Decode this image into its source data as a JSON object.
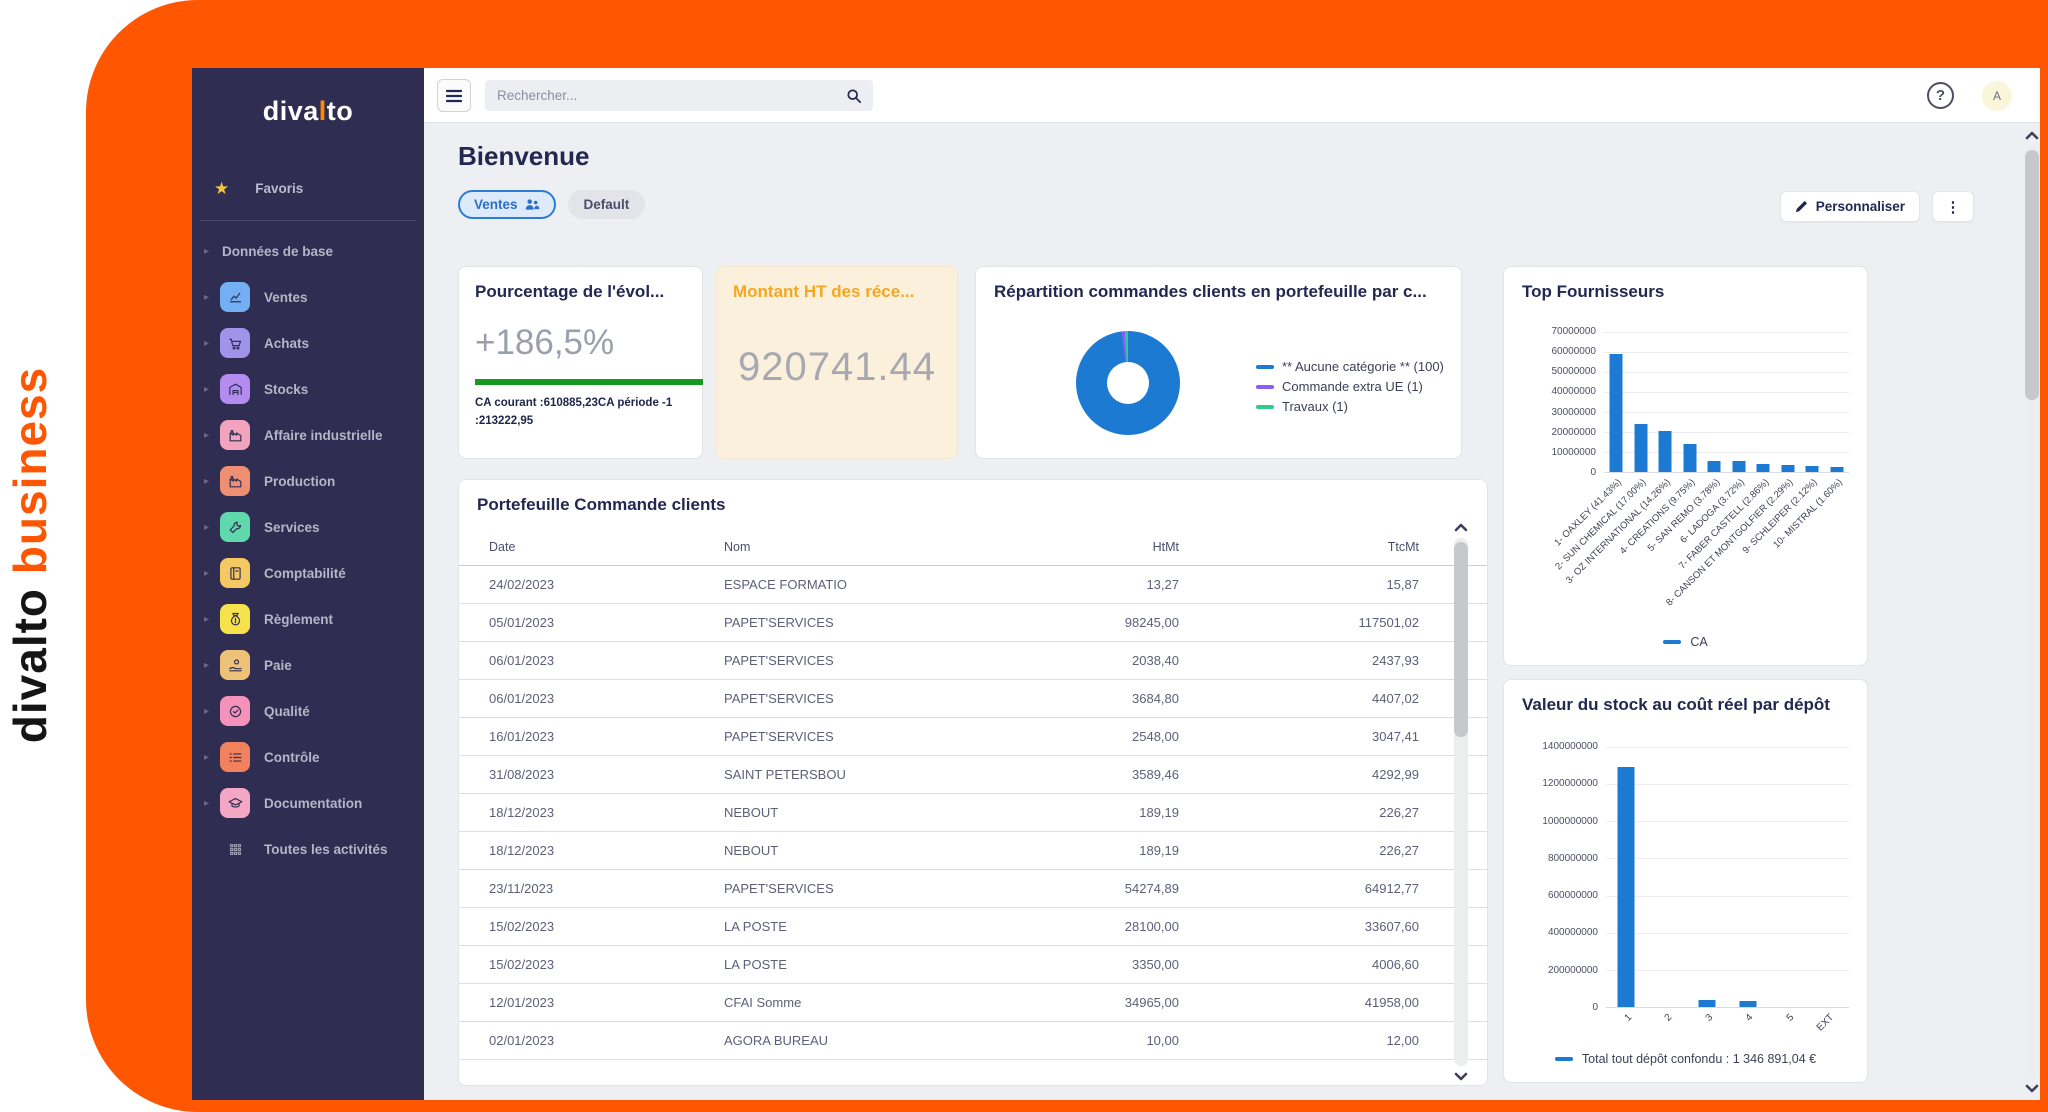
{
  "brand": {
    "vertical_black": "divalto",
    "vertical_orange": "business",
    "logo_pre": "diva",
    "logo_accent": "l",
    "logo_post": "to"
  },
  "colors": {
    "orange": "#ff5601",
    "sidebar_bg": "#2f2d52",
    "bar_blue": "#1d7ad3",
    "green": "#189a21",
    "amber": "#f5a623",
    "purple": "#8b5cf6",
    "teal": "#2fcc8e"
  },
  "topbar": {
    "search_placeholder": "Rechercher...",
    "avatar_initial": "A",
    "help_label": "?"
  },
  "page": {
    "title": "Bienvenue",
    "tabs": [
      {
        "label": "Ventes",
        "active": true
      },
      {
        "label": "Default",
        "active": false
      }
    ],
    "personalize_label": "Personnaliser",
    "kebab_label": "⋮"
  },
  "sidebar": {
    "favorites_label": "Favoris",
    "items": [
      {
        "label": "Données de base",
        "icon": "none",
        "color": ""
      },
      {
        "label": "Ventes",
        "icon": "chart-icon",
        "color": "#74aef3"
      },
      {
        "label": "Achats",
        "icon": "cart-icon",
        "color": "#a193ea"
      },
      {
        "label": "Stocks",
        "icon": "warehouse-icon",
        "color": "#b48cef"
      },
      {
        "label": "Affaire industrielle",
        "icon": "factory-icon",
        "color": "#f2a3bd"
      },
      {
        "label": "Production",
        "icon": "factory-icon",
        "color": "#ee8f73"
      },
      {
        "label": "Services",
        "icon": "wrench-icon",
        "color": "#5fd8ab"
      },
      {
        "label": "Comptabilité",
        "icon": "book-icon",
        "color": "#f4c863"
      },
      {
        "label": "Règlement",
        "icon": "moneybag-icon",
        "color": "#f6e24d"
      },
      {
        "label": "Paie",
        "icon": "hand-coin-icon",
        "color": "#edc278"
      },
      {
        "label": "Qualité",
        "icon": "rosette-icon",
        "color": "#f492ba"
      },
      {
        "label": "Contrôle",
        "icon": "checklist-icon",
        "color": "#f2815d"
      },
      {
        "label": "Documentation",
        "icon": "graduation-icon",
        "color": "#f4a6c5"
      }
    ],
    "all_activities_label": "Toutes les activités"
  },
  "cards": {
    "evolution": {
      "title": "Pourcentage de l'évol...",
      "value": "+186,5%",
      "caption": "CA courant :610885,23CA période -1 :213222,95"
    },
    "montant": {
      "title": "Montant HT des réce...",
      "value": "920741.44"
    },
    "repartition": {
      "title": "Répartition commandes clients en portefeuille par c..."
    },
    "top_fournisseurs": {
      "title": "Top Fournisseurs"
    },
    "portefeuille": {
      "title": "Portefeuille Commande clients"
    },
    "stock": {
      "title": "Valeur du stock au coût réel par dépôt"
    }
  },
  "table": {
    "columns": [
      "Date",
      "Nom",
      "HtMt",
      "TtcMt"
    ],
    "rows": [
      [
        "24/02/2023",
        "ESPACE FORMATIO",
        "13,27",
        "15,87"
      ],
      [
        "05/01/2023",
        "PAPET'SERVICES",
        "98245,00",
        "117501,02"
      ],
      [
        "06/01/2023",
        "PAPET'SERVICES",
        "2038,40",
        "2437,93"
      ],
      [
        "06/01/2023",
        "PAPET'SERVICES",
        "3684,80",
        "4407,02"
      ],
      [
        "16/01/2023",
        "PAPET'SERVICES",
        "2548,00",
        "3047,41"
      ],
      [
        "31/08/2023",
        "SAINT PETERSBOU",
        "3589,46",
        "4292,99"
      ],
      [
        "18/12/2023",
        "NEBOUT",
        "189,19",
        "226,27"
      ],
      [
        "18/12/2023",
        "NEBOUT",
        "189,19",
        "226,27"
      ],
      [
        "23/11/2023",
        "PAPET'SERVICES",
        "54274,89",
        "64912,77"
      ],
      [
        "15/02/2023",
        "LA POSTE",
        "28100,00",
        "33607,60"
      ],
      [
        "15/02/2023",
        "LA POSTE",
        "3350,00",
        "4006,60"
      ],
      [
        "12/01/2023",
        "CFAI Somme",
        "34965,00",
        "41958,00"
      ],
      [
        "02/01/2023",
        "AGORA BUREAU",
        "10,00",
        "12,00"
      ]
    ]
  },
  "chart_data": [
    {
      "type": "pie",
      "donut": true,
      "title": "Répartition commandes clients en portefeuille par c...",
      "labels": [
        "** Aucune catégorie ** (100)",
        "Commande extra UE (1)",
        "Travaux (1)"
      ],
      "values": [
        100,
        1,
        1
      ],
      "colors": [
        "#1d7ad3",
        "#8b5cf6",
        "#2fcc8e"
      ],
      "legend_position": "right"
    },
    {
      "type": "bar",
      "title": "Top Fournisseurs",
      "categories": [
        "1- OAXLEY (41.43%)",
        "2- SUN CHEMICAL (17.00%)",
        "3- OZ INTERNATIONAL (14.26%)",
        "4- CREATIONS (9.75%)",
        "5- SAN REMO (3.78%)",
        "6- LADOGA (3.72%)",
        "7- FABER CASTELL (2.86%)",
        "8- CANSON ET MONTGOLFIER (2.29%)",
        "9- SCHLEIPER (2.12%)",
        "10- MISTRAL (1.60%)"
      ],
      "values": [
        59000000,
        24200000,
        20300000,
        13900000,
        5400000,
        5300000,
        4100000,
        3300000,
        3000000,
        2300000
      ],
      "ylim": [
        0,
        70000000
      ],
      "yticks": [
        "70000000",
        "60000000",
        "50000000",
        "40000000",
        "30000000",
        "20000000",
        "10000000",
        "0"
      ],
      "grid": true,
      "legend": [
        "CA"
      ],
      "legend_position": "bottom",
      "bar_color": "#1d7ad3"
    },
    {
      "type": "bar",
      "title": "Valeur du stock au coût réel par dépôt",
      "categories": [
        "1",
        "2",
        "3",
        "4",
        "5",
        "EXT"
      ],
      "values": [
        1290000000,
        0,
        40000000,
        35000000,
        0,
        0
      ],
      "ylim": [
        0,
        1400000000
      ],
      "yticks": [
        "1400000000",
        "1200000000",
        "1000000000",
        "800000000",
        "600000000",
        "400000000",
        "200000000",
        "0"
      ],
      "grid": true,
      "legend": [
        "Total tout dépôt confondu : 1 346 891,04 €"
      ],
      "legend_position": "bottom",
      "bar_color": "#1d7ad3"
    }
  ]
}
